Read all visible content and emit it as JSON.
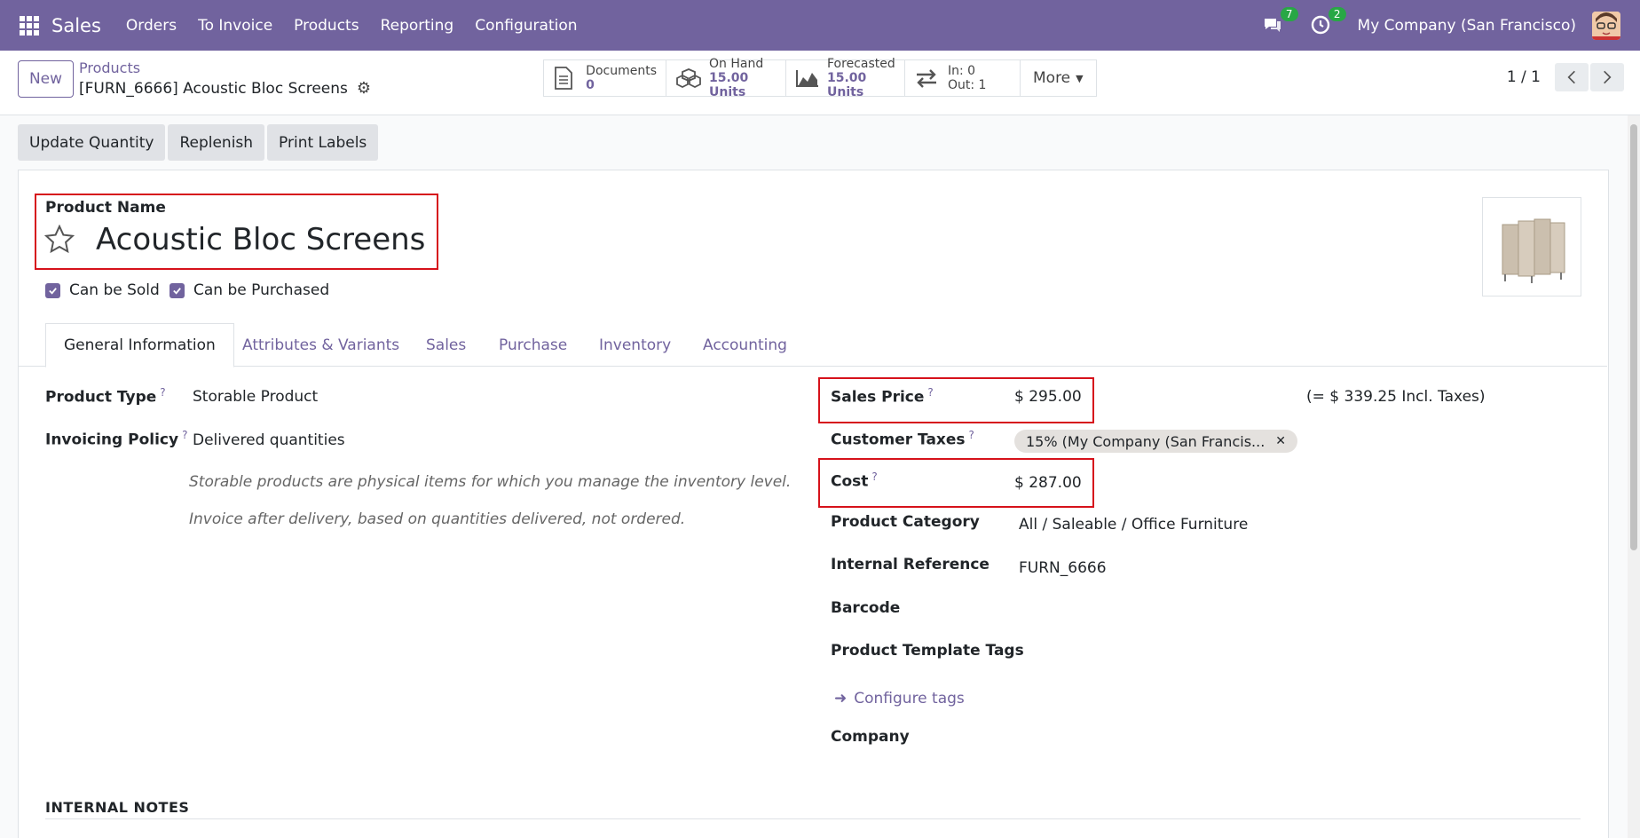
{
  "navbar": {
    "app_name": "Sales",
    "menu": [
      "Orders",
      "To Invoice",
      "Products",
      "Reporting",
      "Configuration"
    ],
    "messages_count": "7",
    "activities_count": "2",
    "company": "My Company (San Francisco)",
    "accent_color": "#71639e"
  },
  "control_panel": {
    "new_label": "New",
    "breadcrumb_parent": "Products",
    "breadcrumb_current": "[FURN_6666] Acoustic Bloc Screens",
    "stats": {
      "documents_label": "Documents",
      "documents_value": "0",
      "onhand_label": "On Hand",
      "onhand_value": "15.00 Units",
      "forecasted_label": "Forecasted",
      "forecasted_value": "15.00 Units",
      "in_label": "In: 0",
      "out_label": "Out: 1",
      "more_label": "More"
    },
    "pager": "1 / 1"
  },
  "actions": {
    "update_quantity": "Update Quantity",
    "replenish": "Replenish",
    "print_labels": "Print Labels"
  },
  "product": {
    "name_label": "Product Name",
    "name": "Acoustic Bloc Screens",
    "can_be_sold": "Can be Sold",
    "can_be_purchased": "Can be Purchased"
  },
  "tabs": [
    "General Information",
    "Attributes & Variants",
    "Sales",
    "Purchase",
    "Inventory",
    "Accounting"
  ],
  "fields": {
    "product_type_label": "Product Type",
    "product_type": "Storable Product",
    "invoicing_policy_label": "Invoicing Policy",
    "invoicing_policy": "Delivered quantities",
    "help_storable": "Storable products are physical items for which you manage the inventory level.",
    "help_invoice": "Invoice after delivery, based on quantities delivered, not ordered.",
    "sales_price_label": "Sales Price",
    "sales_price": "$ 295.00",
    "incl_taxes": "(= $ 339.25 Incl. Taxes)",
    "customer_taxes_label": "Customer Taxes",
    "customer_tax_tag": "15% (My Company (San Francis...",
    "cost_label": "Cost",
    "cost": "$ 287.00",
    "category_label": "Product Category",
    "category": "All / Saleable / Office Furniture",
    "internal_ref_label": "Internal Reference",
    "internal_ref": "FURN_6666",
    "barcode_label": "Barcode",
    "template_tags_label": "Product Template Tags",
    "configure_tags": "Configure tags",
    "company_label": "Company",
    "help_mark": "?"
  },
  "notes": {
    "title": "INTERNAL NOTES"
  }
}
